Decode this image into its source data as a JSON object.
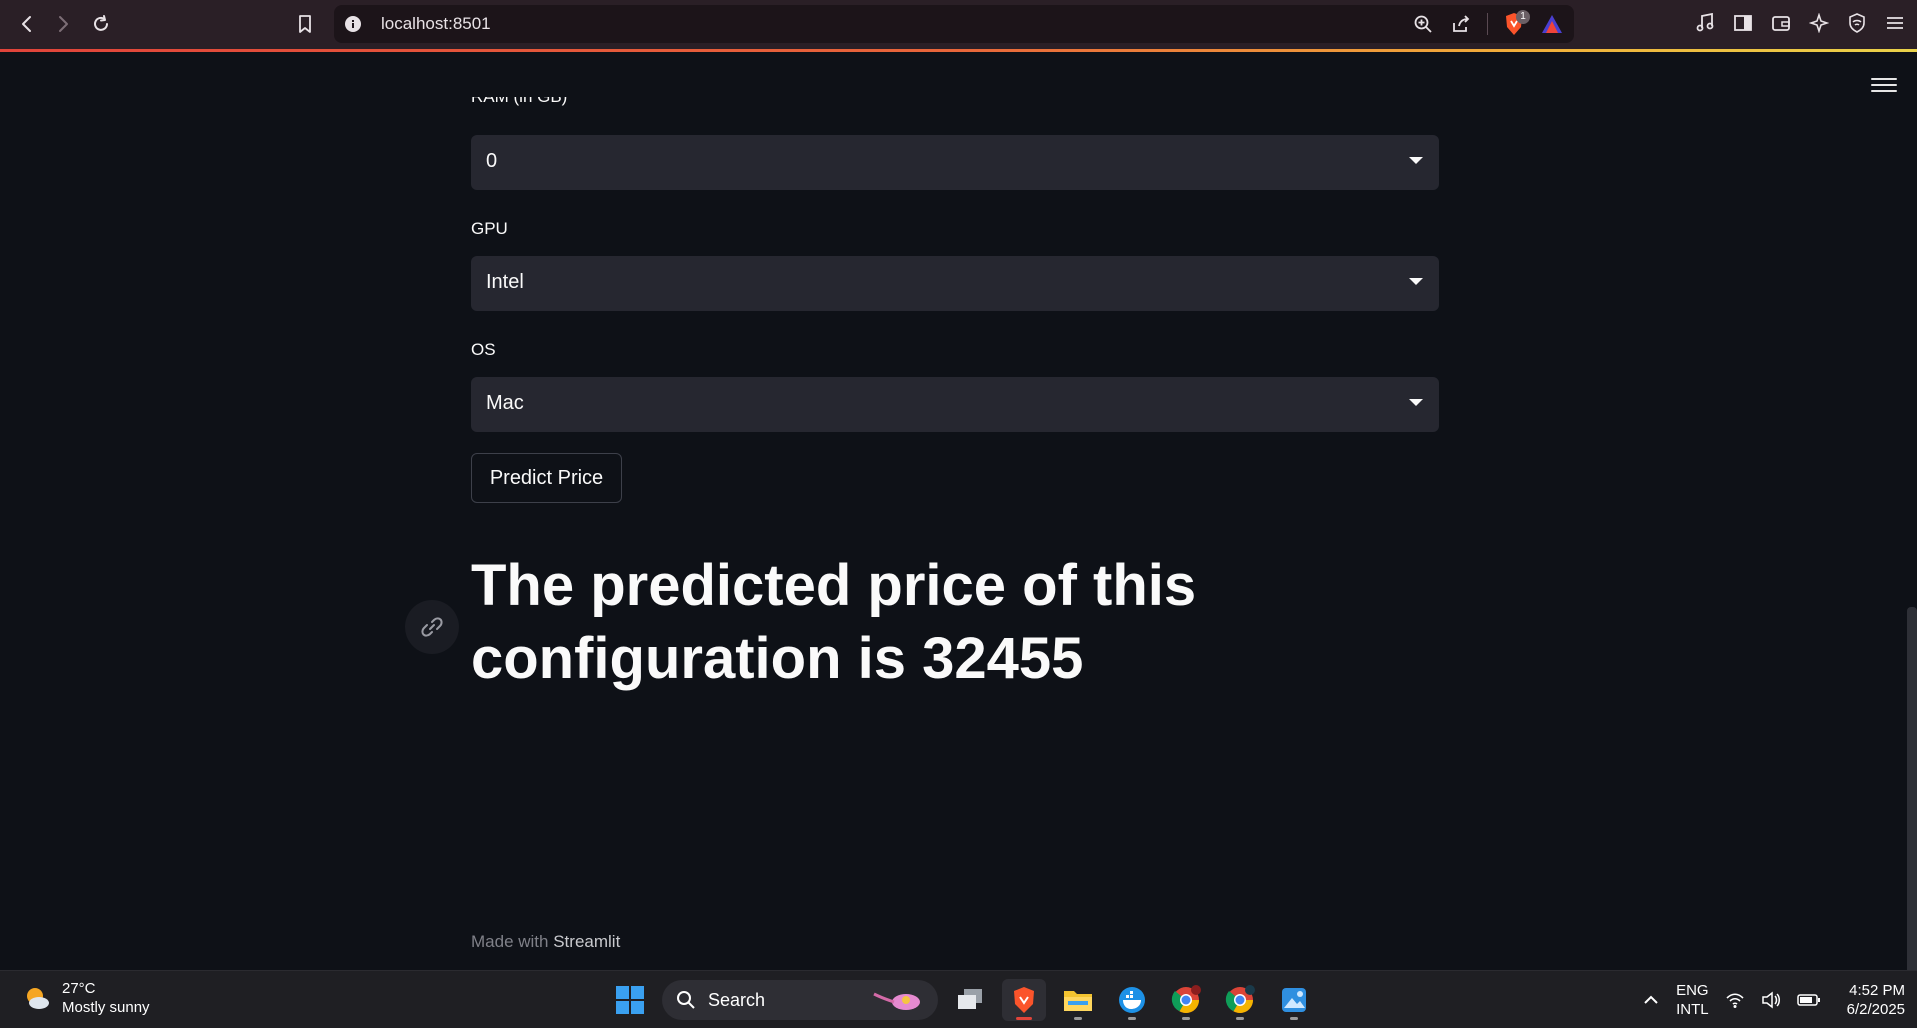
{
  "browser": {
    "url": "localhost:8501",
    "accent_color": "#e0443a",
    "badge_count": "1"
  },
  "form": {
    "ram_label_partial": "RAM (in GB)",
    "ssd_select": {
      "value": "0"
    },
    "gpu_label": "GPU",
    "gpu_select": {
      "value": "Intel"
    },
    "os_label": "OS",
    "os_select": {
      "value": "Mac"
    },
    "predict_button": "Predict Price"
  },
  "result": {
    "heading": "The predicted price of this configuration is 32455"
  },
  "footer": {
    "prefix": "Made with",
    "brand": "Streamlit"
  },
  "taskbar": {
    "weather_temp": "27°C",
    "weather_desc": "Mostly sunny",
    "search_label": "Search",
    "lang_top": "ENG",
    "lang_bottom": "INTL",
    "time": "4:52 PM",
    "date": "6/2/2025"
  }
}
